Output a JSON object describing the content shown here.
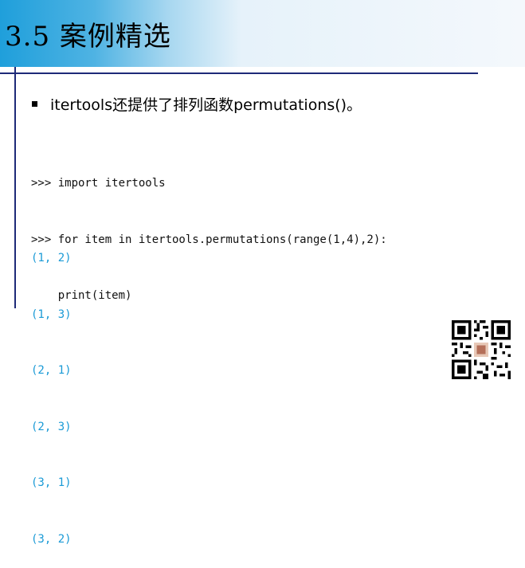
{
  "slide": {
    "title": "3.5  案例精选",
    "bullet": "itertools还提供了排列函数permutations()。"
  },
  "code_input": [
    ">>> import itertools",
    ">>> for item in itertools.permutations(range(1,4),2):",
    "    print(item)"
  ],
  "code_output": [
    "(1, 2)",
    "(1, 3)",
    "(2, 1)",
    "(2, 3)",
    "(3, 1)",
    "(3, 2)"
  ],
  "colors": {
    "title_gradient_start": "#1f9fdb",
    "rule": "#1e2a78",
    "output_text": "#1a9ad6"
  },
  "icons": {
    "qr": "qr-code-icon"
  }
}
